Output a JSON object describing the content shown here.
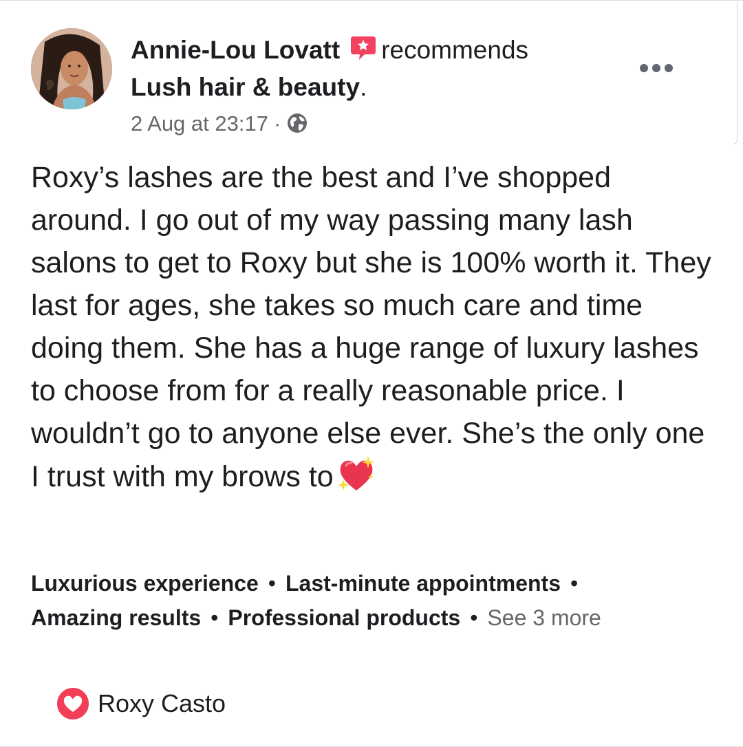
{
  "post": {
    "author": "Annie-Lou  Lovatt",
    "action": "recommends",
    "page_name": "Lush hair & beauty",
    "page_suffix": ".",
    "timestamp": "2 Aug at 23:17",
    "meta_separator": "·",
    "privacy_icon": "globe-icon",
    "recommend_icon": "recommend-badge-icon",
    "more_icon": "more-options-icon",
    "body": "Roxy’s lashes are the best and I’ve shopped around. I go out of my way passing many lash salons to get to Roxy but she is 100% worth it. They last for ages, she takes so much care and time doing them. She has a huge range of luxury lashes to choose from for a really reasonable price. I wouldn’t go to anyone else ever. She’s the only one I trust with my brows to",
    "body_emoji": "sparkling-heart-emoji"
  },
  "tags": {
    "items": [
      "Luxurious experience",
      "Last-minute appointments",
      "Amazing results",
      "Professional products"
    ],
    "bullet": "•",
    "see_more": "See 3 more"
  },
  "reactions": {
    "icon": "love-reaction-icon",
    "names": "Roxy Casto"
  },
  "colors": {
    "text": "#1c1e21",
    "secondary": "#65676b",
    "recommend_red": "#f3425f",
    "love_red": "#f33e58"
  }
}
